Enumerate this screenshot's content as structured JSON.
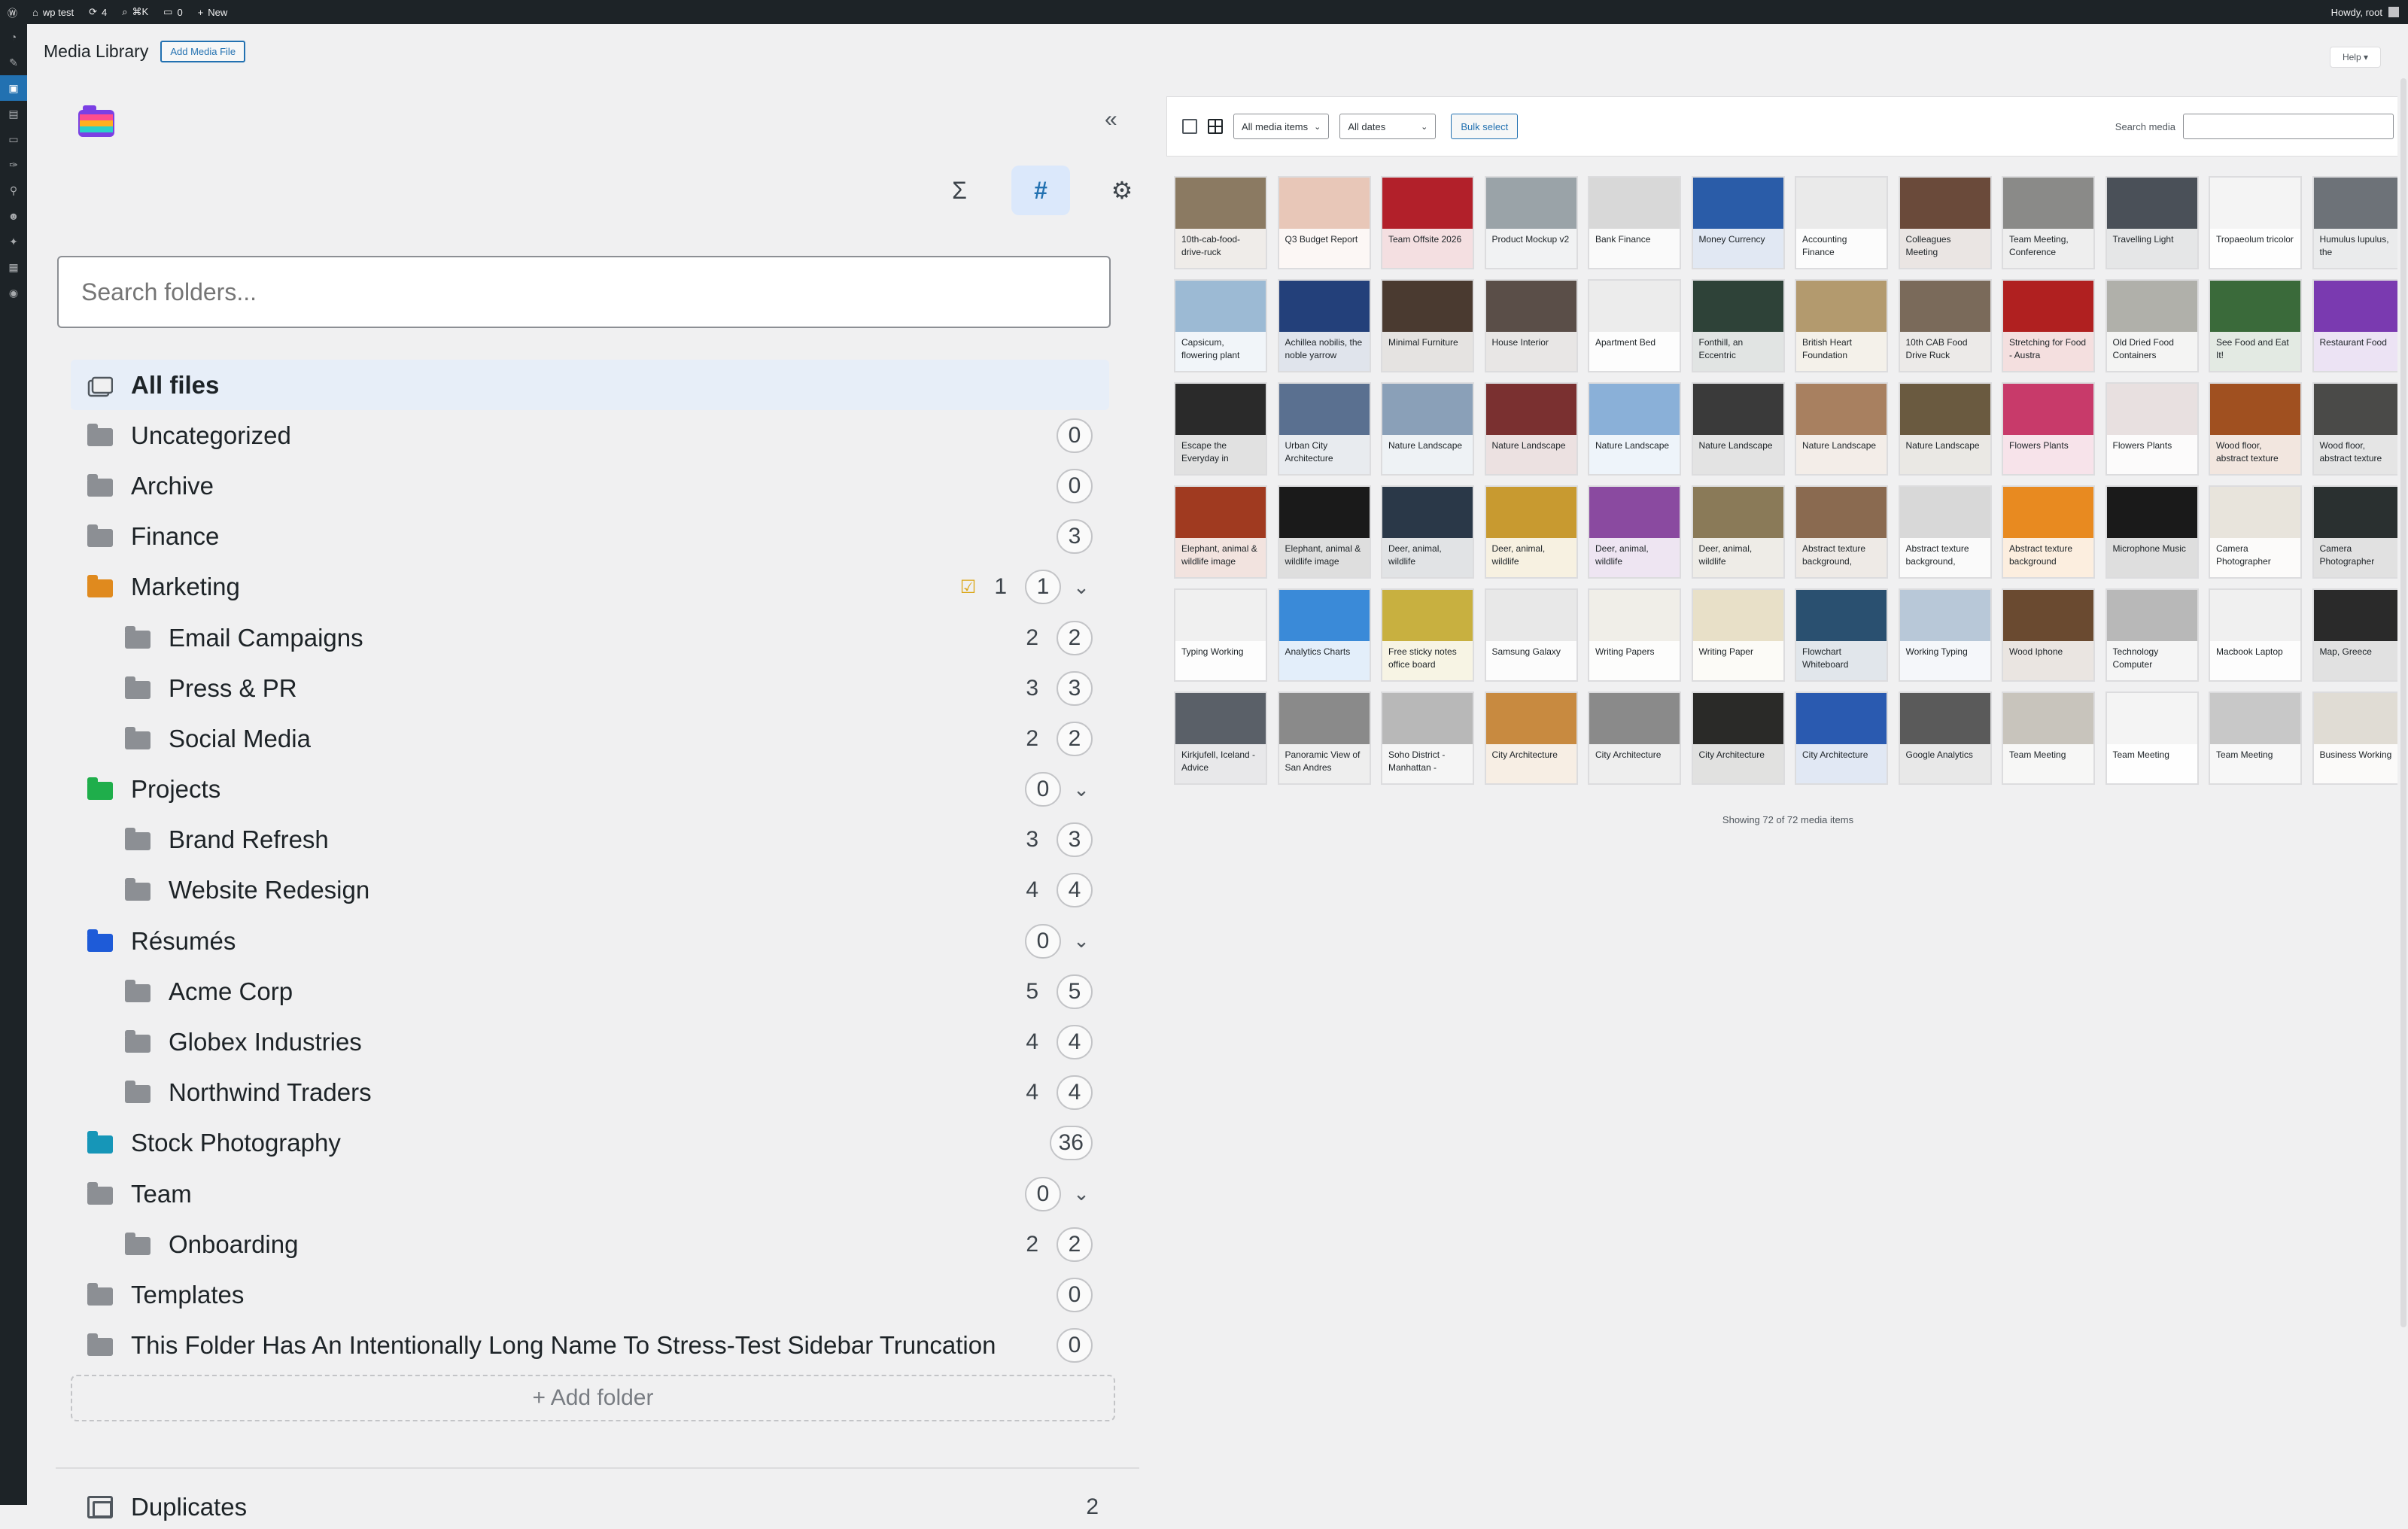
{
  "admin_bar": {
    "site_name": "wp test",
    "updates_count": "4",
    "search_shortcut": "⌘K",
    "comments_count": "0",
    "new_label": "New",
    "howdy": "Howdy, root"
  },
  "page": {
    "title": "Media Library",
    "add_button": "Add Media File",
    "help": "Help ▾"
  },
  "folders_panel": {
    "search_placeholder": "Search folders...",
    "tools": [
      "Σ",
      "#",
      "⚙"
    ],
    "add_folder": "+ Add folder",
    "duplicates": {
      "label": "Duplicates",
      "count": "2"
    },
    "items": [
      {
        "name": "All files",
        "level": 0,
        "color": "",
        "bold": true,
        "active": true
      },
      {
        "name": "Uncategorized",
        "level": 0,
        "color": "#8c8f94",
        "counts": [
          "0"
        ]
      },
      {
        "name": "Archive",
        "level": 0,
        "color": "#8c8f94",
        "counts": [
          "0"
        ]
      },
      {
        "name": "Finance",
        "level": 0,
        "color": "#8c8f94",
        "counts": [
          "3"
        ]
      },
      {
        "name": "Marketing",
        "level": 0,
        "color": "#e08a1e",
        "counts": [
          "1",
          "1"
        ],
        "check": true,
        "expand": true
      },
      {
        "name": "Email Campaigns",
        "level": 1,
        "color": "#8c8f94",
        "counts": [
          "2",
          "2"
        ]
      },
      {
        "name": "Press & PR",
        "level": 1,
        "color": "#8c8f94",
        "counts": [
          "3",
          "3"
        ]
      },
      {
        "name": "Social Media",
        "level": 1,
        "color": "#8c8f94",
        "counts": [
          "2",
          "2"
        ]
      },
      {
        "name": "Projects",
        "level": 0,
        "color": "#1fae4b",
        "counts": [
          "0"
        ],
        "expand": true
      },
      {
        "name": "Brand Refresh",
        "level": 1,
        "color": "#8c8f94",
        "counts": [
          "3",
          "3"
        ]
      },
      {
        "name": "Website Redesign",
        "level": 1,
        "color": "#8c8f94",
        "counts": [
          "4",
          "4"
        ]
      },
      {
        "name": "Résumés",
        "level": 0,
        "color": "#1e5bd8",
        "counts": [
          "0"
        ],
        "expand": true
      },
      {
        "name": "Acme Corp",
        "level": 1,
        "color": "#8c8f94",
        "counts": [
          "5",
          "5"
        ]
      },
      {
        "name": "Globex Industries",
        "level": 1,
        "color": "#8c8f94",
        "counts": [
          "4",
          "4"
        ]
      },
      {
        "name": "Northwind Traders",
        "level": 1,
        "color": "#8c8f94",
        "counts": [
          "4",
          "4"
        ]
      },
      {
        "name": "Stock Photography",
        "level": 0,
        "color": "#1696b8",
        "counts": [
          "36"
        ]
      },
      {
        "name": "Team",
        "level": 0,
        "color": "#8c8f94",
        "counts": [
          "0"
        ],
        "expand": true
      },
      {
        "name": "Onboarding",
        "level": 1,
        "color": "#8c8f94",
        "counts": [
          "2",
          "2"
        ]
      },
      {
        "name": "Templates",
        "level": 0,
        "color": "#8c8f94",
        "counts": [
          "0"
        ]
      },
      {
        "name": "This Folder Has An Intentionally Long Name To Stress-Test Sidebar Truncation",
        "level": 0,
        "color": "#8c8f94",
        "counts": [
          "0"
        ]
      }
    ]
  },
  "media_toolbar": {
    "type_filter": "All media items",
    "date_filter": "All dates",
    "bulk_select": "Bulk select",
    "search_label": "Search media"
  },
  "media_count_text": "Showing 72 of 72 media items",
  "media_items": [
    {
      "title": "10th-cab-food-drive-ruck",
      "color": "#8b7a62"
    },
    {
      "title": "Q3 Budget Report",
      "color": "#e8c7b8"
    },
    {
      "title": "Team Offsite 2026",
      "color": "#b2202a"
    },
    {
      "title": "Product Mockup v2",
      "color": "#9aa3a8"
    },
    {
      "title": "Bank Finance",
      "color": "#d8d8d8"
    },
    {
      "title": "Money Currency",
      "color": "#2a5ca8"
    },
    {
      "title": "Accounting Finance",
      "color": "#eaeaea"
    },
    {
      "title": "Colleagues Meeting",
      "color": "#6a4a3a"
    },
    {
      "title": "Team Meeting, Conference",
      "color": "#8a8a88"
    },
    {
      "title": "Travelling Light",
      "color": "#4a5058"
    },
    {
      "title": "Tropaeolum tricolor",
      "color": "#f4f4f4"
    },
    {
      "title": "Humulus lupulus, the",
      "color": "#6d7278"
    },
    {
      "title": "Capsicum, flowering plant",
      "color": "#9cbad4"
    },
    {
      "title": "Achillea nobilis, the noble yarrow",
      "color": "#23407a"
    },
    {
      "title": "Minimal Furniture",
      "color": "#4a3a30"
    },
    {
      "title": "House Interior",
      "color": "#5a4e48"
    },
    {
      "title": "Apartment Bed",
      "color": "#ececec"
    },
    {
      "title": "Fonthill, an Eccentric",
      "color": "#2e4238"
    },
    {
      "title": "British Heart Foundation",
      "color": "#b39a6e"
    },
    {
      "title": "10th CAB Food Drive Ruck",
      "color": "#7a6a5a"
    },
    {
      "title": "Stretching for Food - Austra",
      "color": "#b02020"
    },
    {
      "title": "Old Dried Food Containers",
      "color": "#b0b0aa"
    },
    {
      "title": "See Food and Eat It!",
      "color": "#3a6a3a"
    },
    {
      "title": "Restaurant Food",
      "color": "#7a3ab0"
    },
    {
      "title": "Escape the Everyday in",
      "color": "#2a2a2a"
    },
    {
      "title": "Urban City Architecture",
      "color": "#5a7090"
    },
    {
      "title": "Nature Landscape",
      "color": "#8aa0b8"
    },
    {
      "title": "Nature Landscape",
      "color": "#7a3030"
    },
    {
      "title": "Nature Landscape",
      "color": "#8ab0d8"
    },
    {
      "title": "Nature Landscape",
      "color": "#3a3a3a"
    },
    {
      "title": "Nature Landscape",
      "color": "#a88060"
    },
    {
      "title": "Nature Landscape",
      "color": "#6a5a40"
    },
    {
      "title": "Flowers Plants",
      "color": "#c83a6a"
    },
    {
      "title": "Flowers Plants",
      "color": "#e8e0e0"
    },
    {
      "title": "Wood floor, abstract texture",
      "color": "#a05020"
    },
    {
      "title": "Wood floor, abstract texture",
      "color": "#4a4a48"
    },
    {
      "title": "Elephant, animal & wildlife image",
      "color": "#a03a20"
    },
    {
      "title": "Elephant, animal & wildlife image",
      "color": "#1a1a1a"
    },
    {
      "title": "Deer, animal, wildlife",
      "color": "#2a3848"
    },
    {
      "title": "Deer, animal, wildlife",
      "color": "#c89a30"
    },
    {
      "title": "Deer, animal, wildlife",
      "color": "#8a4aa0"
    },
    {
      "title": "Deer, animal, wildlife",
      "color": "#8a7a58"
    },
    {
      "title": "Abstract texture background,",
      "color": "#8a6a50"
    },
    {
      "title": "Abstract texture background,",
      "color": "#d8d8d8"
    },
    {
      "title": "Abstract texture background",
      "color": "#e88a20"
    },
    {
      "title": "Microphone Music",
      "color": "#1a1a1a"
    },
    {
      "title": "Camera Photographer",
      "color": "#e8e4dc"
    },
    {
      "title": "Camera Photographer",
      "color": "#2a3030"
    },
    {
      "title": "Typing Working",
      "color": "#f0f0f0"
    },
    {
      "title": "Analytics Charts",
      "color": "#3a8ad8"
    },
    {
      "title": "Free sticky notes office board",
      "color": "#c8b040"
    },
    {
      "title": "Samsung Galaxy",
      "color": "#e8e8e8"
    },
    {
      "title": "Writing Papers",
      "color": "#f0eee8"
    },
    {
      "title": "Writing Paper",
      "color": "#e8e0c8"
    },
    {
      "title": "Flowchart Whiteboard",
      "color": "#2a5070"
    },
    {
      "title": "Working Typing",
      "color": "#b8c8d8"
    },
    {
      "title": "Wood Iphone",
      "color": "#6a4a30"
    },
    {
      "title": "Technology Computer",
      "color": "#b8b8b8"
    },
    {
      "title": "Macbook Laptop",
      "color": "#f0f0f0"
    },
    {
      "title": "Map, Greece",
      "color": "#2a2a2a"
    },
    {
      "title": "Kirkjufell, Iceland - Advice",
      "color": "#5a6068"
    },
    {
      "title": "Panoramic View of San Andres",
      "color": "#8a8a8a"
    },
    {
      "title": "Soho District - Manhattan -",
      "color": "#b8b8b8"
    },
    {
      "title": "City Architecture",
      "color": "#c88a40"
    },
    {
      "title": "City Architecture",
      "color": "#8a8a8a"
    },
    {
      "title": "City Architecture",
      "color": "#2a2a28"
    },
    {
      "title": "City Architecture",
      "color": "#2a5ab0"
    },
    {
      "title": "Google Analytics",
      "color": "#5a5a5a"
    },
    {
      "title": "Team Meeting",
      "color": "#c8c4bc"
    },
    {
      "title": "Team Meeting",
      "color": "#f4f4f4"
    },
    {
      "title": "Team Meeting",
      "color": "#c8c8c8"
    },
    {
      "title": "Business Working",
      "color": "#e0dcd4"
    }
  ],
  "side_menu_icons": [
    "dashboard-icon",
    "posts-icon",
    "media-icon",
    "pages-icon",
    "comments-icon",
    "appearance-icon",
    "plugins-icon",
    "users-icon",
    "tools-icon",
    "settings-icon",
    "collapse-icon"
  ]
}
